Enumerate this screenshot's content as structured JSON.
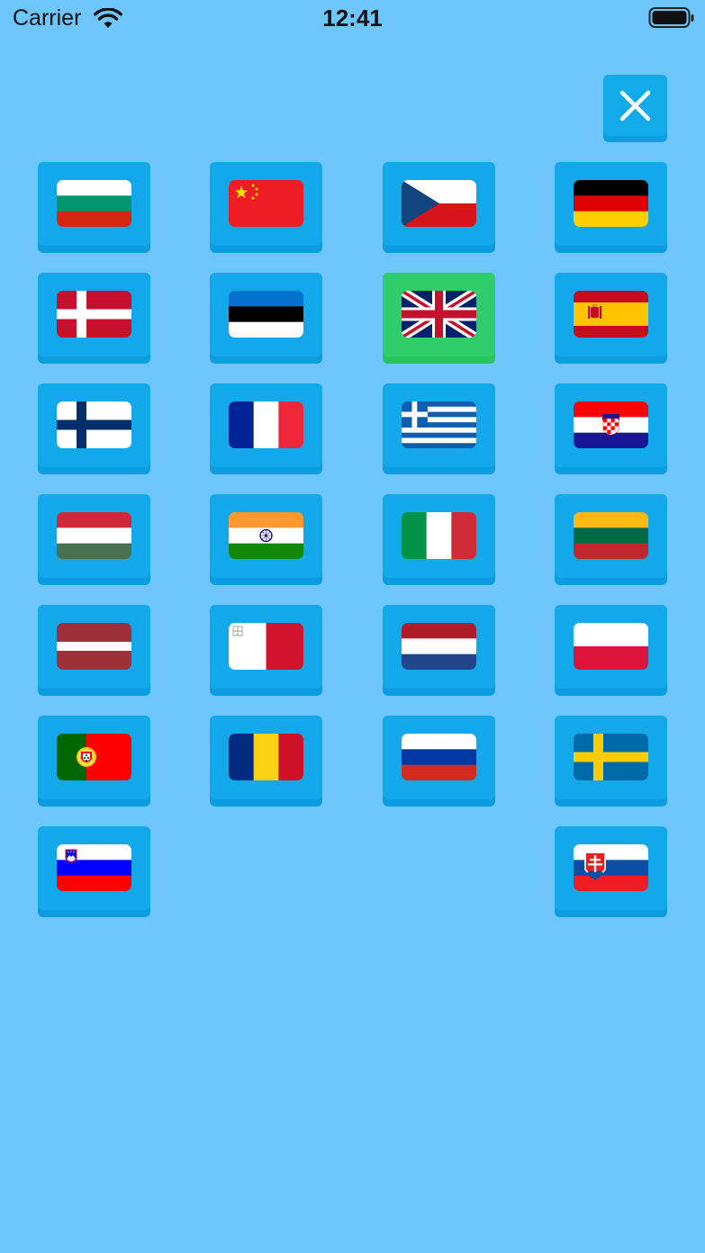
{
  "status_bar": {
    "carrier": "Carrier",
    "time": "12:41"
  },
  "close_button": {
    "icon": "close-icon"
  },
  "colors": {
    "background": "#6fc6fd",
    "tile": "#12a8ea",
    "tile_selected": "#2ecc6b"
  },
  "languages": [
    {
      "code": "bg",
      "icon": "bulgaria-flag-icon",
      "selected": false
    },
    {
      "code": "zh",
      "icon": "china-flag-icon",
      "selected": false
    },
    {
      "code": "cs",
      "icon": "czech-flag-icon",
      "selected": false
    },
    {
      "code": "de",
      "icon": "germany-flag-icon",
      "selected": false
    },
    {
      "code": "da",
      "icon": "denmark-flag-icon",
      "selected": false
    },
    {
      "code": "et",
      "icon": "estonia-flag-icon",
      "selected": false
    },
    {
      "code": "en",
      "icon": "united-kingdom-flag-icon",
      "selected": true
    },
    {
      "code": "es",
      "icon": "spain-flag-icon",
      "selected": false
    },
    {
      "code": "fi",
      "icon": "finland-flag-icon",
      "selected": false
    },
    {
      "code": "fr",
      "icon": "france-flag-icon",
      "selected": false
    },
    {
      "code": "el",
      "icon": "greece-flag-icon",
      "selected": false
    },
    {
      "code": "hr",
      "icon": "croatia-flag-icon",
      "selected": false
    },
    {
      "code": "hu",
      "icon": "hungary-flag-icon",
      "selected": false
    },
    {
      "code": "hi",
      "icon": "india-flag-icon",
      "selected": false
    },
    {
      "code": "it",
      "icon": "italy-flag-icon",
      "selected": false
    },
    {
      "code": "lt",
      "icon": "lithuania-flag-icon",
      "selected": false
    },
    {
      "code": "lv",
      "icon": "latvia-flag-icon",
      "selected": false
    },
    {
      "code": "mt",
      "icon": "malta-flag-icon",
      "selected": false
    },
    {
      "code": "nl",
      "icon": "netherlands-flag-icon",
      "selected": false
    },
    {
      "code": "pl",
      "icon": "poland-flag-icon",
      "selected": false
    },
    {
      "code": "pt",
      "icon": "portugal-flag-icon",
      "selected": false
    },
    {
      "code": "ro",
      "icon": "romania-flag-icon",
      "selected": false
    },
    {
      "code": "ru",
      "icon": "russia-flag-icon",
      "selected": false
    },
    {
      "code": "sv",
      "icon": "sweden-flag-icon",
      "selected": false
    },
    {
      "code": "sl",
      "icon": "slovenia-flag-icon",
      "selected": false
    },
    {
      "code": "sk",
      "icon": "slovakia-flag-icon",
      "selected": false
    }
  ]
}
